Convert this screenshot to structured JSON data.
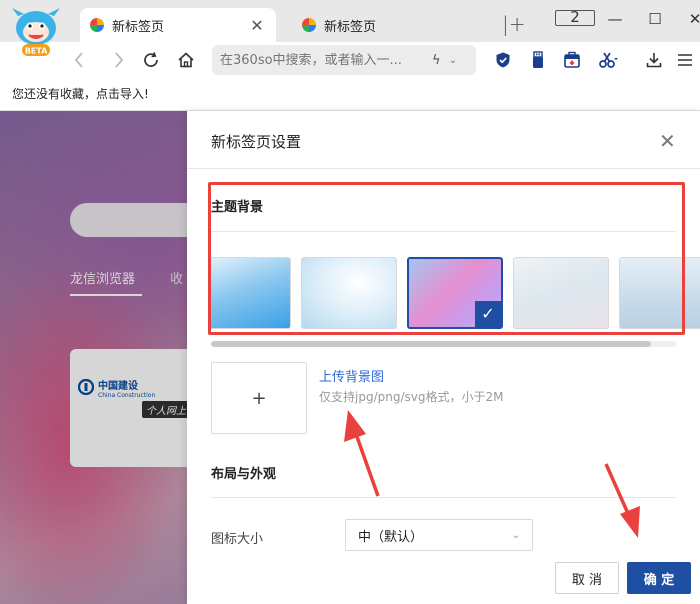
{
  "browser": {
    "logo_badge": "BETA",
    "tabs": [
      {
        "title": "新标签页",
        "close": "✕"
      },
      {
        "title": "新标签页"
      }
    ],
    "new_tab_symbol": "|+",
    "tab_count": "2",
    "window_controls": {
      "minimize": "—",
      "maximize": "☐",
      "close": "✕"
    }
  },
  "toolbar": {
    "back_icon": "chevron-left-icon",
    "forward_icon": "chevron-right-icon",
    "address_placeholder": "在360so中搜索，或者输入一...",
    "address_value": "在360so中搜索，或者输入一...",
    "bolt": "ϟ",
    "chev": "⌄"
  },
  "bookmarks": {
    "empty_text": "您还没有收藏，点击导入!"
  },
  "background_page": {
    "tabs": [
      "龙信浏览器",
      "收"
    ],
    "card": {
      "bank_name": "中国建设",
      "bank_name_en": "China Construction",
      "tag": "个人网上"
    }
  },
  "panel": {
    "title": "新标签页设置",
    "close": "✕",
    "theme": {
      "label": "主题背景",
      "selected_index": 2,
      "check": "✓"
    },
    "upload": {
      "plus": "+",
      "link": "上传背景图",
      "hint": "仅支持jpg/png/svg格式，小于2M"
    },
    "layout": {
      "label": "布局与外观",
      "icon_size_label": "图标大小",
      "icon_size_value": "中（默认）",
      "caret": "⌄"
    },
    "buttons": {
      "cancel": "取 消",
      "ok": "确 定"
    }
  },
  "colors": {
    "accent": "#1e4fa3",
    "link": "#2d6bd6",
    "highlight": "#e8413e"
  }
}
